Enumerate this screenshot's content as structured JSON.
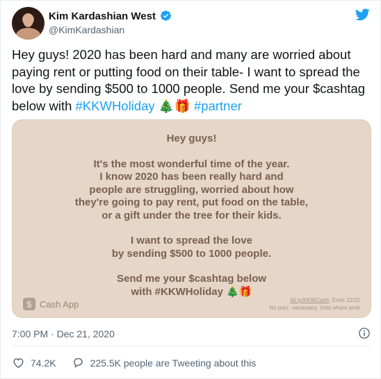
{
  "tweet": {
    "author": {
      "display_name": "Kim Kardashian West",
      "handle": "@KimKardashian",
      "verified": true
    },
    "text_plain": "Hey guys! 2020 has been hard and many are worried about paying rent or putting food on their table- I want to spread the love by sending $500 to 1000 people. Send me your $cashtag below with ",
    "hashtag_1": "#KKWHoliday",
    "emoji": "🎄🎁",
    "hashtag_2": "#partner",
    "timestamp": "7:00 PM · Dec 21, 2020",
    "likes": "74.2K",
    "tweeting_about": "225.5K people are Tweeting about this"
  },
  "media": {
    "line_1": "Hey guys!",
    "line_2": "It's the most wonderful time of the year.",
    "line_3": "I know 2020 has been really hard and",
    "line_4": "people are struggling, worried about how",
    "line_5": "they're going to pay rent, put food on the table,",
    "line_6": "or a gift under the tree for their kids.",
    "line_7": "I want to spread the love",
    "line_8": "by sending $500 to 1000 people.",
    "line_9": "Send me your $cashtag below",
    "line_10": "with #KKWHoliday 🎄🎁",
    "brand_logo_glyph": "$",
    "brand": "Cash App",
    "fineprint_link": "bit.ly/KKWCash",
    "fineprint_ends": ". Ends 12/22",
    "fineprint_line2": "No purc. necessary. Void where proh"
  },
  "colors": {
    "accent": "#1da1f2",
    "media_bg": "#e5d6c7",
    "media_text": "#7a5f4e",
    "muted": "#536471"
  },
  "icons": [
    "verified-badge-icon",
    "twitter-bird-icon",
    "info-icon",
    "heart-icon",
    "reply-bubble-icon",
    "cash-app-logo-icon"
  ]
}
